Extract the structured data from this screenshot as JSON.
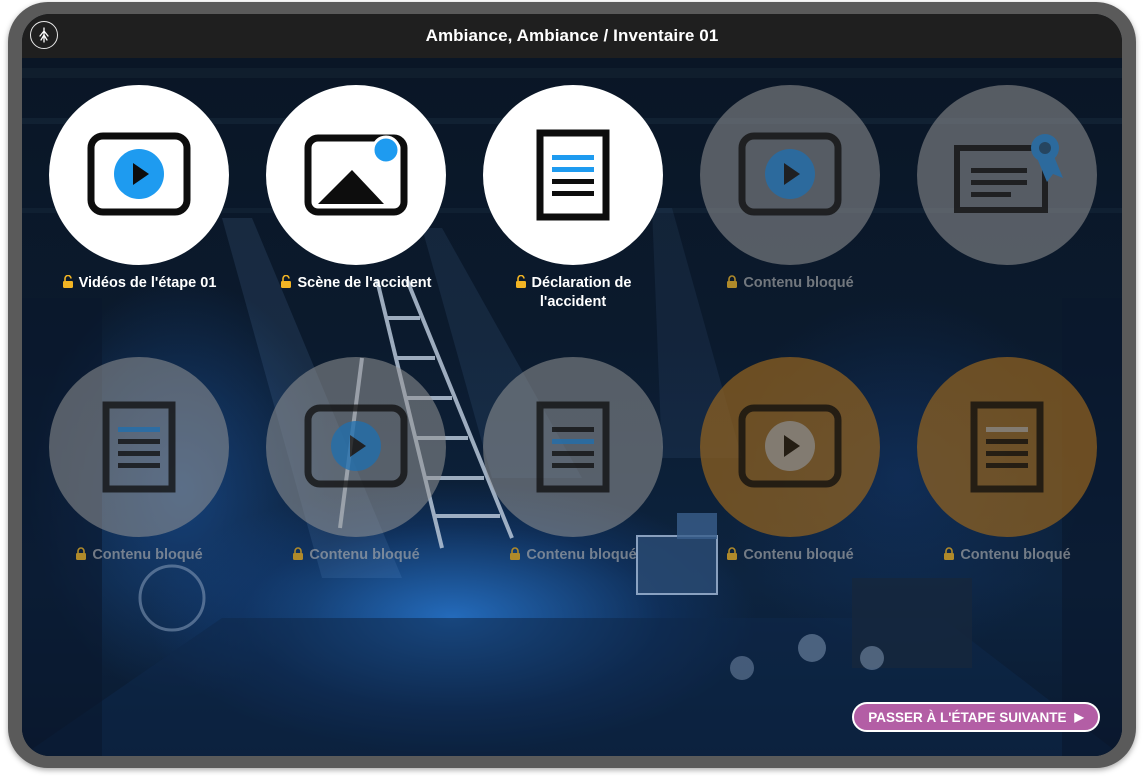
{
  "header": {
    "title": "Ambiance, Ambiance / Inventaire 01",
    "logo_icon": "tree-logo-icon"
  },
  "tiles": [
    {
      "label": "Vidéos de l'étape 01",
      "icon": "video-play-icon",
      "state": "unlocked"
    },
    {
      "label": "Scène de l'accident",
      "icon": "image-icon",
      "state": "unlocked"
    },
    {
      "label": "Déclaration de l'accident",
      "icon": "document-icon",
      "state": "unlocked"
    },
    {
      "label": "Contenu bloqué",
      "icon": "video-play-icon",
      "state": "locked"
    },
    {
      "label": "",
      "icon": "certificate-icon",
      "state": "locked"
    },
    {
      "label": "Contenu bloqué",
      "icon": "document-icon",
      "state": "locked"
    },
    {
      "label": "Contenu bloqué",
      "icon": "video-play-icon",
      "state": "locked"
    },
    {
      "label": "Contenu bloqué",
      "icon": "document-icon",
      "state": "locked"
    },
    {
      "label": "Contenu bloqué",
      "icon": "video-play-icon",
      "state": "locked-orange"
    },
    {
      "label": "Contenu bloqué",
      "icon": "document-icon",
      "state": "locked-orange"
    }
  ],
  "next_button": {
    "label": "PASSER À L'ÉTAPE SUIVANTE",
    "icon": "play-arrow-icon"
  },
  "colors": {
    "accent_blue": "#1e9bf0",
    "button_pink": "#b35ea5",
    "lock_gold": "#f2b424"
  }
}
